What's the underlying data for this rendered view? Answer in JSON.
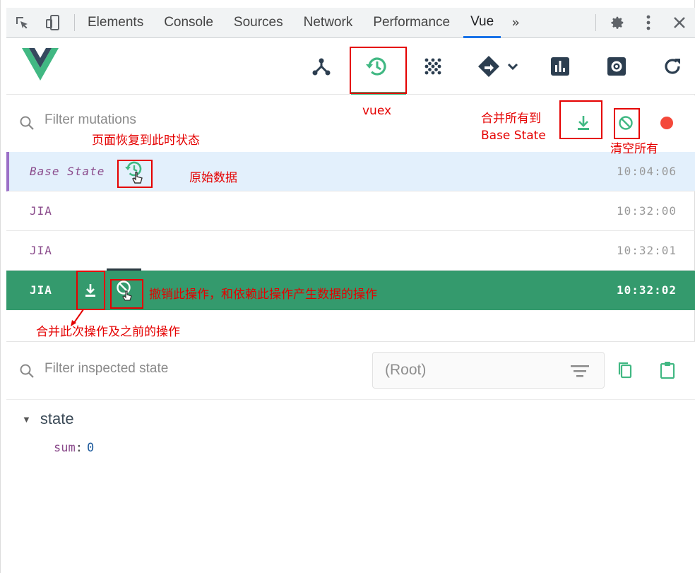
{
  "devtools": {
    "tabs": [
      "Elements",
      "Console",
      "Sources",
      "Network",
      "Performance",
      "Vue"
    ],
    "active_tab": "Vue",
    "more": "»"
  },
  "vue_toolbar": {
    "icons": [
      "components-icon",
      "timeline-history-icon",
      "performance-icon",
      "routing-icon",
      "chart-icon",
      "settings-icon",
      "refresh-icon"
    ],
    "active": "vuex"
  },
  "mutations": {
    "filter_placeholder": "Filter mutations",
    "rows": [
      {
        "name": "Base State",
        "time": "10:04:06"
      },
      {
        "name": "JIA",
        "time": "10:32:00"
      },
      {
        "name": "JIA",
        "time": "10:32:01"
      },
      {
        "name": "JIA",
        "time": "10:32:02"
      }
    ]
  },
  "inspector": {
    "filter_placeholder": "Filter inspected state",
    "root_select": "(Root)",
    "state_label": "state",
    "props": [
      {
        "key": "sum",
        "value": "0"
      }
    ]
  },
  "annotations": {
    "vuex": "vuex",
    "merge_all_line1": "合并所有到",
    "merge_all_line2": "Base State",
    "clear_all": "清空所有",
    "restore_state": "页面恢复到此时状态",
    "original_data": "原始数据",
    "revert": "撤销此操作，和依赖此操作产生数据的操作",
    "merge_before": "合并此次操作及之前的操作"
  },
  "colors": {
    "vue_green": "#41b883",
    "vue_dark": "#35495e",
    "selected_row": "#349a6d",
    "base_row": "#e3f0fc",
    "annotation_red": "#e50000",
    "record": "#f4483a"
  }
}
